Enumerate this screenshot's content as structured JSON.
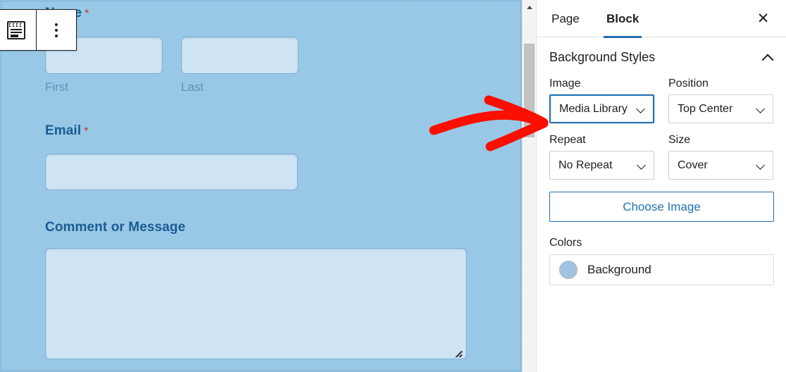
{
  "editor": {
    "toolbar": {
      "block_icon": "form-block-icon",
      "more_options_icon": "more-vertical-dots-icon"
    },
    "form": {
      "fields": [
        {
          "label": "Name",
          "required": true,
          "required_marker": "*",
          "subfields": [
            {
              "sub_label": "First",
              "value": ""
            },
            {
              "sub_label": "Last",
              "value": ""
            }
          ]
        },
        {
          "label": "Email",
          "required": true,
          "required_marker": "*",
          "value": ""
        },
        {
          "label": "Comment or Message",
          "required": false,
          "required_marker": "",
          "value": ""
        }
      ]
    },
    "scrollbar": {
      "up_arrow_icon": "scroll-up-arrow-icon",
      "thumb": "vertical-scroll-thumb"
    }
  },
  "sidebar": {
    "tabs": [
      {
        "label": "Page",
        "active": false
      },
      {
        "label": "Block",
        "active": true
      }
    ],
    "close_icon": "close-icon",
    "close_label": "✕",
    "section": {
      "title": "Background Styles",
      "collapse_icon": "chevron-up-icon",
      "controls": [
        {
          "label": "Image",
          "value": "Media Library",
          "focused": true
        },
        {
          "label": "Position",
          "value": "Top Center",
          "focused": false
        },
        {
          "label": "Repeat",
          "value": "No Repeat",
          "focused": false
        },
        {
          "label": "Size",
          "value": "Cover",
          "focused": false
        }
      ],
      "choose_image_button": "Choose Image",
      "colors_label": "Colors",
      "color_rows": [
        {
          "name": "Background",
          "swatch_color": "#9fc3e0"
        }
      ]
    }
  },
  "annotation": {
    "type": "hand-drawn-arrow",
    "direction": "right",
    "color": "#fa0f00",
    "points_at": "Media Library"
  },
  "colors": {
    "canvas_background": "#98c8e6",
    "field_fill": "#cee4f5",
    "field_border": "#7fb0d4",
    "label_text": "#1a5b92",
    "required_star": "#c0392b",
    "accent_blue": "#2271b1",
    "panel_background": "#ffffff"
  }
}
